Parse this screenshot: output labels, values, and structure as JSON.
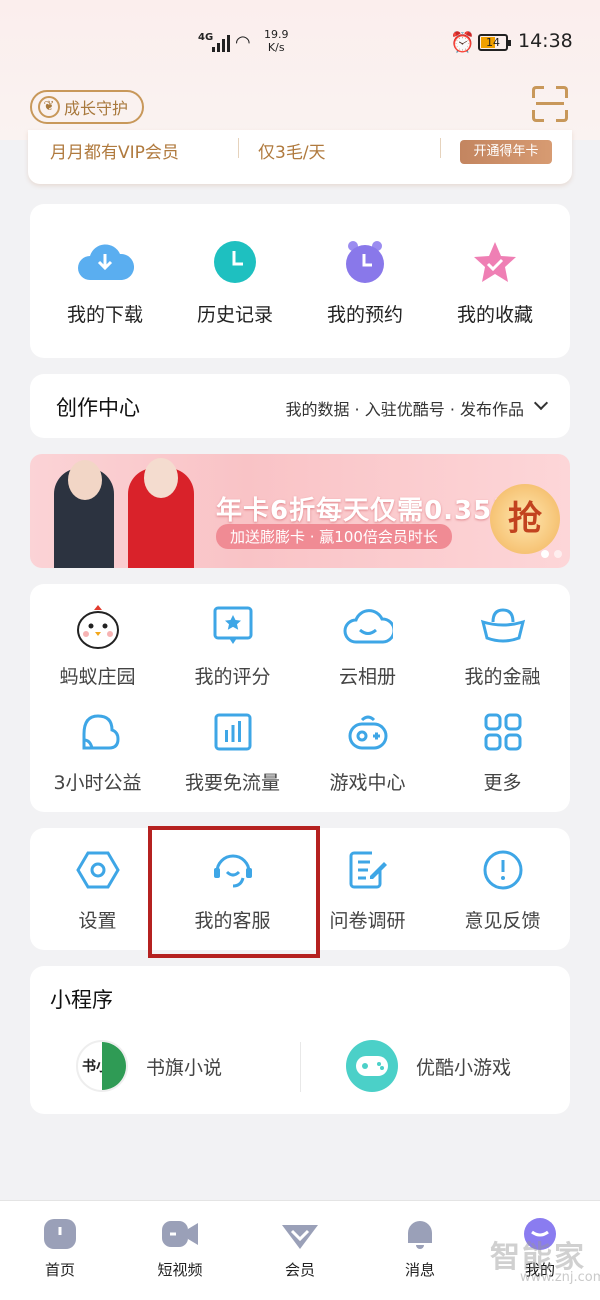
{
  "status_bar": {
    "network": "4G",
    "speed_value": "19.9",
    "speed_unit": "K/s",
    "battery": "14",
    "time": "14:38"
  },
  "header": {
    "growth_guard": "成长守护"
  },
  "vip_strip": {
    "item1": "月月都有VIP会员",
    "item2": "仅3毛/天",
    "button": "开通得年卡"
  },
  "quick_actions": [
    {
      "label": "我的下载",
      "icon": "cloud-download-icon"
    },
    {
      "label": "历史记录",
      "icon": "clock-icon"
    },
    {
      "label": "我的预约",
      "icon": "alarm-icon"
    },
    {
      "label": "我的收藏",
      "icon": "star-icon"
    }
  ],
  "creator": {
    "title": "创作中心",
    "links": "我的数据 · 入驻优酷号 · 发布作品"
  },
  "banner": {
    "headline": "年卡6折每天仅需0.35元",
    "sub": "加送膨膨卡 · 赢100倍会员时长",
    "badge": "抢"
  },
  "services": [
    {
      "label": "蚂蚁庄园",
      "icon": "chick-icon"
    },
    {
      "label": "我的评分",
      "icon": "rating-icon"
    },
    {
      "label": "云相册",
      "icon": "cloud-album-icon"
    },
    {
      "label": "我的金融",
      "icon": "ingot-icon"
    },
    {
      "label": "3小时公益",
      "icon": "charity-icon"
    },
    {
      "label": "我要免流量",
      "icon": "data-bars-icon"
    },
    {
      "label": "游戏中心",
      "icon": "gamepad-icon"
    },
    {
      "label": "更多",
      "icon": "grid-icon"
    }
  ],
  "settings_row": [
    {
      "label": "设置",
      "icon": "hexagon-settings-icon"
    },
    {
      "label": "我的客服",
      "icon": "headset-icon"
    },
    {
      "label": "问卷调研",
      "icon": "survey-icon"
    },
    {
      "label": "意见反馈",
      "icon": "exclamation-icon"
    }
  ],
  "mini_programs": {
    "title": "小程序",
    "apps": [
      {
        "label": "书旗小说",
        "icon": "shuqi-logo-icon",
        "logo_text": "书小说"
      },
      {
        "label": "优酷小游戏",
        "icon": "game-controller-icon"
      }
    ]
  },
  "tabbar": [
    {
      "label": "首页",
      "icon": "home-icon"
    },
    {
      "label": "短视频",
      "icon": "video-camera-icon"
    },
    {
      "label": "会员",
      "icon": "diamond-icon"
    },
    {
      "label": "消息",
      "icon": "bell-icon"
    },
    {
      "label": "我的",
      "icon": "profile-icon"
    }
  ],
  "watermark": {
    "brand": "智能家",
    "url": "www.znj.com"
  },
  "colors": {
    "accent_gold": "#c8985a",
    "blue_icon": "#3ea6e6",
    "highlight_red": "#b52120"
  }
}
